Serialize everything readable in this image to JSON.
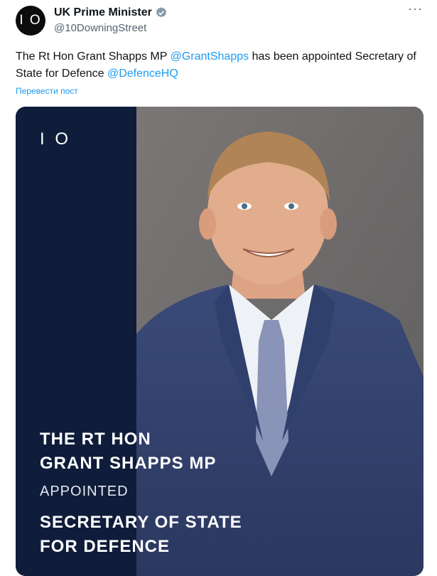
{
  "author": {
    "avatar_text": "I O",
    "name": "UK Prime Minister",
    "handle": "@10DowningStreet"
  },
  "more_icon": "···",
  "tweet": {
    "part1": "The Rt Hon Grant Shapps MP ",
    "mention1": "@GrantShapps",
    "part2": " has been appointed Secretary of State for Defence ",
    "mention2": "@DefenceHQ",
    "translate": "Перевести пост"
  },
  "media": {
    "panel_logo": "I O",
    "headline_line1": "THE RT HON",
    "headline_line2": "GRANT SHAPPS MP",
    "appointed": "APPOINTED",
    "role_line1": "SECRETARY OF STATE",
    "role_line2": "FOR DEFENCE"
  },
  "colors": {
    "link": "#1d9bf0",
    "verified": "#829aab",
    "panel": "#0f1d3b"
  }
}
